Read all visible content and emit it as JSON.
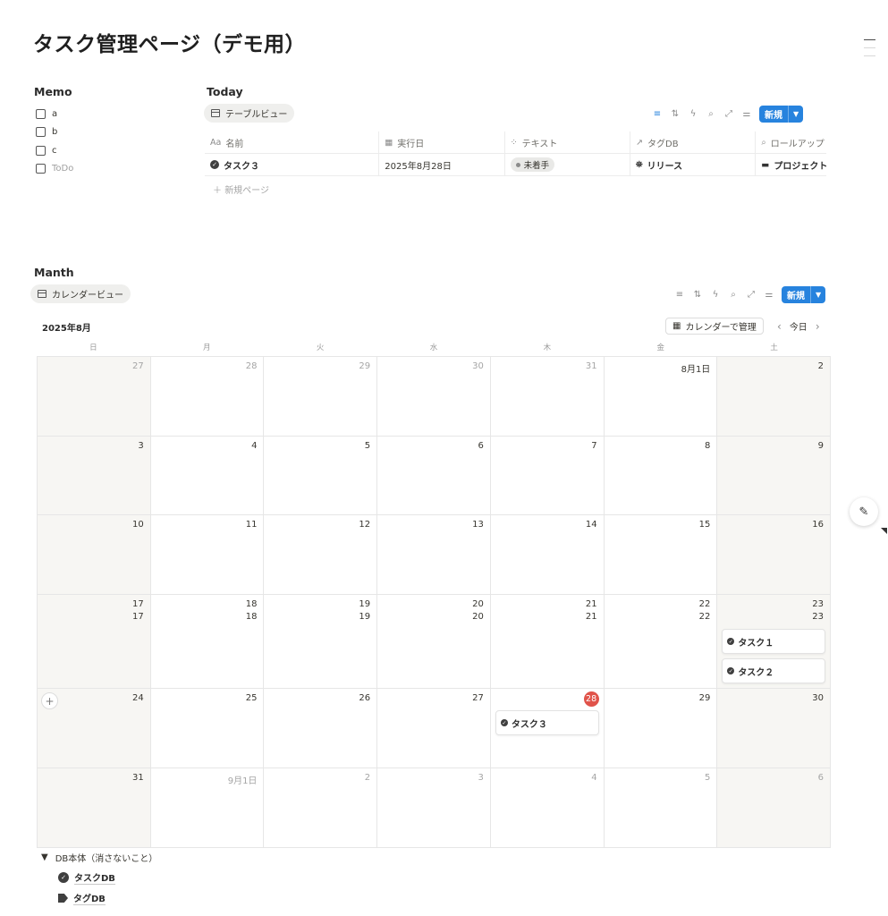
{
  "page": {
    "title": "タスク管理ページ（デモ用）"
  },
  "memo": {
    "label": "Memo",
    "items": [
      {
        "text": "a",
        "placeholder": false
      },
      {
        "text": "b",
        "placeholder": false
      },
      {
        "text": "c",
        "placeholder": false
      },
      {
        "text": "ToDo",
        "placeholder": true
      }
    ]
  },
  "today": {
    "label": "Today",
    "view_label": "テーブルビュー",
    "new_label": "新規",
    "columns": [
      {
        "icon": "Aa",
        "label": "名前"
      },
      {
        "icon": "calendar-icon",
        "label": "実行日"
      },
      {
        "icon": "status-icon",
        "label": "テキスト"
      },
      {
        "icon": "relation-arrow-icon",
        "label": "タグDB"
      },
      {
        "icon": "search-icon",
        "label": "ロールアップ"
      }
    ],
    "rows": [
      {
        "name": "タスク３",
        "date": "2025年8月28日",
        "status": "未着手",
        "tag": "リリース",
        "rollup": "プロジェクト"
      }
    ],
    "new_row_label": "新規ページ"
  },
  "month": {
    "label": "Manth",
    "view_label": "カレンダービュー",
    "new_label": "新規",
    "month_title": "2025年8月",
    "manage_label": "カレンダーで管理",
    "today_label": "今日",
    "weekdays": [
      "日",
      "月",
      "火",
      "水",
      "木",
      "金",
      "土"
    ],
    "weeks": [
      {
        "days": [
          {
            "n": "27",
            "muted": true
          },
          {
            "n": "28",
            "muted": true
          },
          {
            "n": "29",
            "muted": true
          },
          {
            "n": "30",
            "muted": true
          },
          {
            "n": "31",
            "muted": true
          },
          {
            "n": "8月1日",
            "muted": false
          },
          {
            "n": "2",
            "muted": false
          }
        ]
      },
      {
        "days": [
          {
            "n": "3"
          },
          {
            "n": "4"
          },
          {
            "n": "5"
          },
          {
            "n": "6"
          },
          {
            "n": "7"
          },
          {
            "n": "8"
          },
          {
            "n": "9"
          }
        ]
      },
      {
        "days": [
          {
            "n": "10"
          },
          {
            "n": "11"
          },
          {
            "n": "12"
          },
          {
            "n": "13"
          },
          {
            "n": "14"
          },
          {
            "n": "15"
          },
          {
            "n": "16"
          }
        ]
      },
      {
        "days": [
          {
            "n": "17",
            "n2": "17"
          },
          {
            "n": "18",
            "n2": "18"
          },
          {
            "n": "19",
            "n2": "19"
          },
          {
            "n": "20",
            "n2": "20"
          },
          {
            "n": "21",
            "n2": "21"
          },
          {
            "n": "22",
            "n2": "22"
          },
          {
            "n": "23",
            "n2": "23",
            "events": [
              "タスク１",
              "タスク２"
            ]
          }
        ]
      },
      {
        "days": [
          {
            "n": "24",
            "add": true
          },
          {
            "n": "25"
          },
          {
            "n": "26"
          },
          {
            "n": "27"
          },
          {
            "n": "28",
            "today": true,
            "events": [
              "タスク３"
            ]
          },
          {
            "n": "29"
          },
          {
            "n": "30"
          }
        ]
      },
      {
        "days": [
          {
            "n": "31"
          },
          {
            "n": "9月1日",
            "muted": true
          },
          {
            "n": "2",
            "muted": true
          },
          {
            "n": "3",
            "muted": true
          },
          {
            "n": "4",
            "muted": true
          },
          {
            "n": "5",
            "muted": true
          },
          {
            "n": "6",
            "muted": true
          }
        ]
      }
    ]
  },
  "toggle": {
    "label": "DB本体（消さないこと）",
    "items": [
      {
        "icon": "check-circle-icon",
        "label": "タスクDB"
      },
      {
        "icon": "tag-icon",
        "label": "タグDB"
      }
    ]
  },
  "colors": {
    "accent": "#2783de",
    "today_badge": "#e0534a",
    "weekend_bg": "#f7f6f3"
  }
}
